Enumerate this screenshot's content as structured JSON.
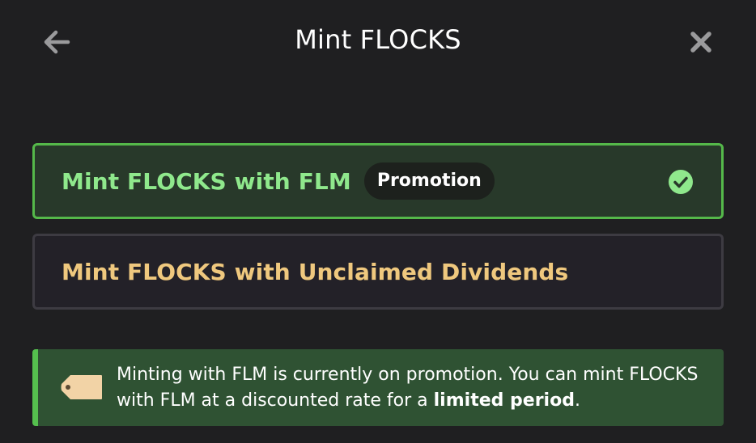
{
  "header": {
    "title": "Mint FLOCKS",
    "back_icon": "arrow-left-icon",
    "close_icon": "close-icon"
  },
  "options": [
    {
      "label": "Mint FLOCKS with FLM",
      "badge": "Promotion",
      "selected": true,
      "status_icon": "check-circle-icon"
    },
    {
      "label": "Mint FLOCKS with Unclaimed Dividends",
      "selected": false
    }
  ],
  "notice": {
    "icon": "price-tag-icon",
    "text_before": "Minting with FLM is currently on promotion. You can mint FLOCKS with FLM at a discounted rate for a ",
    "text_bold": "limited period",
    "text_after": "."
  },
  "colors": {
    "background": "#1f1f21",
    "selected_border": "#55b84a",
    "selected_bg": "#28392a",
    "flm_text": "#8fe88c",
    "dividends_text": "#efc87e",
    "notice_bg": "#2f5233",
    "notice_accent": "#55c04e"
  }
}
